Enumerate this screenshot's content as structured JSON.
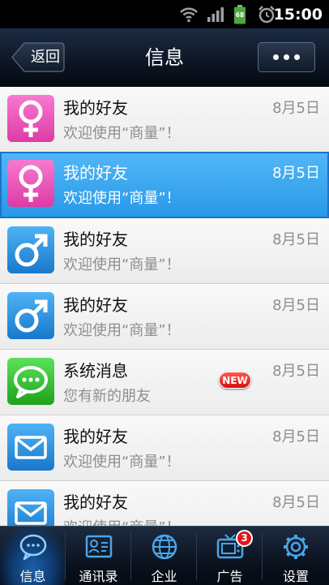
{
  "status_bar": {
    "time": "15:00",
    "battery_level": "68",
    "icons": [
      "wifi-icon",
      "signal-icon",
      "battery-icon",
      "alarm-icon"
    ]
  },
  "header": {
    "back_label": "返回",
    "title": "信息",
    "more_icon": "more-icon"
  },
  "messages": [
    {
      "title": "我的好友",
      "subtitle": "欢迎使用“商量”！",
      "date": "8月5日",
      "avatar": "female-icon",
      "avatar_color": "#ec4fb6"
    },
    {
      "title": "我的好友",
      "subtitle": "欢迎使用“商量”！",
      "date": "8月5日",
      "avatar": "female-icon",
      "avatar_color": "#ec4fb6",
      "selected": true
    },
    {
      "title": "我的好友",
      "subtitle": "欢迎使用“商量”！",
      "date": "8月5日",
      "avatar": "male-icon",
      "avatar_color": "#1e8fde"
    },
    {
      "title": "我的好友",
      "subtitle": "欢迎使用“商量”！",
      "date": "8月5日",
      "avatar": "male-icon",
      "avatar_color": "#1e8fde"
    },
    {
      "title": "系统消息",
      "subtitle": "您有新的朋友",
      "date": "8月5日",
      "avatar": "chat-bubble-icon",
      "avatar_color": "#2fbf2a",
      "badge": "NEW"
    },
    {
      "title": "我的好友",
      "subtitle": "欢迎使用“商量”！",
      "date": "8月5日",
      "avatar": "envelope-icon",
      "avatar_color": "#1e8fde"
    },
    {
      "title": "我的好友",
      "subtitle": "欢迎使用“商量”！",
      "date": "8月5日",
      "avatar": "envelope-icon",
      "avatar_color": "#1e8fde"
    }
  ],
  "tabbar": {
    "active": 0,
    "tabs": [
      {
        "label": "信息",
        "icon": "message-icon"
      },
      {
        "label": "通讯录",
        "icon": "contacts-icon"
      },
      {
        "label": "企业",
        "icon": "globe-icon"
      },
      {
        "label": "广告",
        "icon": "tv-icon",
        "badge": "3"
      },
      {
        "label": "设置",
        "icon": "gear-icon"
      }
    ]
  },
  "colors": {
    "accent_selected": "#2899e8",
    "header_bg": "#0d1726",
    "badge_red": "#e0151b"
  }
}
